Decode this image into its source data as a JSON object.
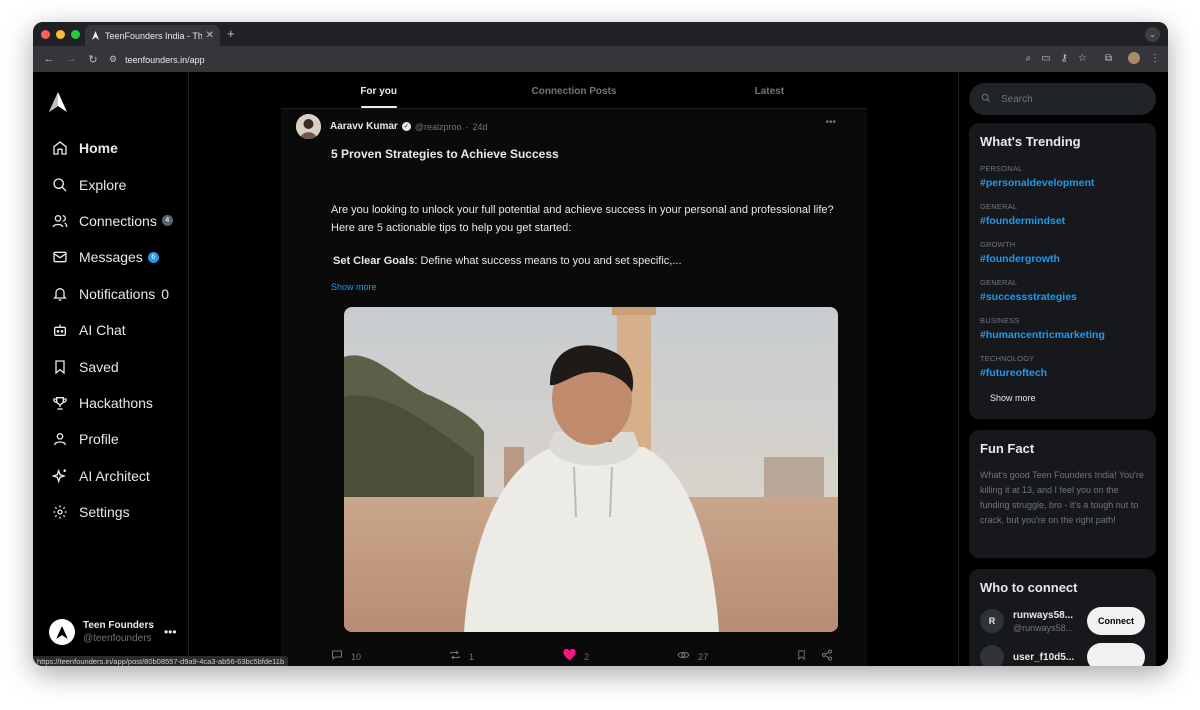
{
  "browser": {
    "tab_title": "TeenFounders India - The So",
    "tab_close": "✕",
    "new_tab": "+",
    "url": "teenfounders.in/app",
    "status_url": "https://teenfounders.in/app/post/80b08557-d9a9-4ca3-ab56-63bc5bfde11b"
  },
  "sidebar": {
    "items": [
      {
        "label": "Home",
        "icon": "home-icon",
        "badge": ""
      },
      {
        "label": "Explore",
        "icon": "search-icon",
        "badge": ""
      },
      {
        "label": "Connections",
        "icon": "users-icon",
        "badge": "4"
      },
      {
        "label": "Messages",
        "icon": "mail-icon",
        "badge": "6"
      },
      {
        "label": "Notifications",
        "icon": "bell-icon",
        "badge": "0"
      },
      {
        "label": "AI Chat",
        "icon": "bot-icon",
        "badge": ""
      },
      {
        "label": "Saved",
        "icon": "bookmark-icon",
        "badge": ""
      },
      {
        "label": "Hackathons",
        "icon": "trophy-icon",
        "badge": ""
      },
      {
        "label": "Profile",
        "icon": "user-icon",
        "badge": ""
      },
      {
        "label": "AI Architect",
        "icon": "sparkles-icon",
        "badge": ""
      },
      {
        "label": "Settings",
        "icon": "gear-icon",
        "badge": ""
      }
    ],
    "profile": {
      "name": "Teen Founders",
      "handle": "@teenfounders",
      "more": "•••"
    }
  },
  "feed": {
    "tabs": [
      {
        "label": "For you"
      },
      {
        "label": "Connection Posts"
      },
      {
        "label": "Latest"
      }
    ],
    "post": {
      "author": "Aaravv Kumar",
      "handle": "@realzproo",
      "separator": "·",
      "time": "24d",
      "more": "•••",
      "title": "5 Proven Strategies to Achieve Success",
      "body": "Are you looking to unlock your full potential and achieve success in your personal and professional life? Here are 5 actionable tips to help you get started:",
      "point_bold": "Set Clear Goals",
      "point_text": ": Define what success means to you and set specific,...",
      "show_more": "Show more",
      "stats": {
        "comments": "10",
        "reposts": "1",
        "likes": "2",
        "views": "27"
      }
    }
  },
  "right": {
    "search_placeholder": "Search",
    "trending": {
      "title": "What's Trending",
      "items": [
        {
          "category": "PERSONAL",
          "tag": "#personaldevelopment"
        },
        {
          "category": "GENERAL",
          "tag": "#foundermindset"
        },
        {
          "category": "GROWTH",
          "tag": "#foundergrowth"
        },
        {
          "category": "GENERAL",
          "tag": "#successstrategies"
        },
        {
          "category": "BUSINESS",
          "tag": "#humancentricmarketing"
        },
        {
          "category": "TECHNOLOGY",
          "tag": "#futureoftech"
        }
      ],
      "show_more": "Show more"
    },
    "fun_fact": {
      "title": "Fun Fact",
      "text": "What's good Teen Founders India! You're killing it at 13, and I feel you on the funding struggle, bro - it's a tough nut to crack, but you're on the right path!"
    },
    "who_to_connect": {
      "title": "Who to connect",
      "users": [
        {
          "initial": "R",
          "name": "runways58...",
          "handle": "@runways58...",
          "button": "Connect"
        },
        {
          "initial": "",
          "name": "user_f10d5...",
          "handle": "",
          "button": ""
        }
      ]
    }
  },
  "colors": {
    "accent": "#1d9bf0",
    "like": "#f91880",
    "background": "#000000",
    "card": "#16181c"
  }
}
